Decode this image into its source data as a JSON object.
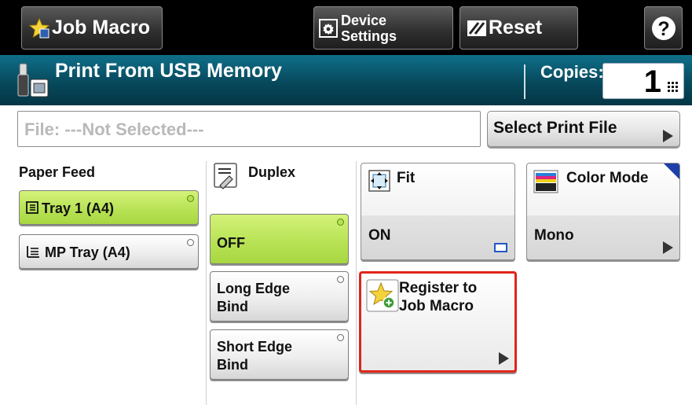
{
  "toolbar": {
    "job_macro_label": "Job Macro",
    "device_settings_label_1": "Device",
    "device_settings_label_2": "Settings",
    "reset_label": "Reset",
    "help_label": "?"
  },
  "header": {
    "title": "Print From USB Memory",
    "copies_label": "Copies:",
    "copies_value": "1"
  },
  "file": {
    "field_text": "File: ---Not Selected---",
    "select_button_label": "Select Print File"
  },
  "paper_feed": {
    "label": "Paper Feed",
    "options": [
      {
        "label": "Tray 1 (A4)",
        "selected": true
      },
      {
        "label": "MP Tray (A4)",
        "selected": false
      }
    ]
  },
  "duplex": {
    "label": "Duplex",
    "options": [
      {
        "label_1": "OFF",
        "label_2": "",
        "selected": true
      },
      {
        "label_1": "Long Edge",
        "label_2": "Bind",
        "selected": false
      },
      {
        "label_1": "Short Edge",
        "label_2": "Bind",
        "selected": false
      }
    ]
  },
  "tiles": {
    "fit": {
      "label": "Fit",
      "value": "ON"
    },
    "color_mode": {
      "label": "Color Mode",
      "value": "Mono"
    },
    "register": {
      "label_1": "Register to",
      "label_2": "Job Macro"
    }
  },
  "colors": {
    "selected_green": "#b6e153",
    "header_teal": "#07495c",
    "highlight_red": "#e0251b"
  }
}
